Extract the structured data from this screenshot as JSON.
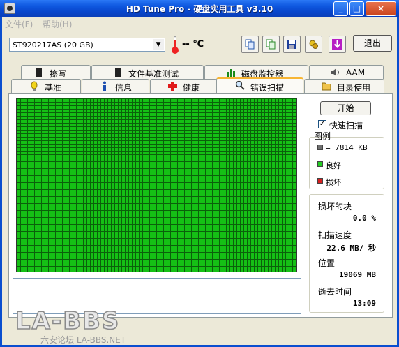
{
  "window": {
    "title": "HD Tune Pro - 硬盘实用工具 v3.10",
    "minimize": "_",
    "maximize": "□",
    "close": "×"
  },
  "menu": [
    {
      "label": "文件(F)"
    },
    {
      "label": "帮助(H)"
    }
  ],
  "drive": {
    "selected": "ST920217AS (20 GB)",
    "temperature": "-- ℃"
  },
  "toolbar": {
    "exit_label": "退出",
    "icons": [
      "copy-icon",
      "copy-info-icon",
      "save-icon",
      "settings-icon",
      "download-icon"
    ]
  },
  "tabs_top": [
    {
      "label": "擦写",
      "icon": "erase-icon"
    },
    {
      "label": "文件基准测试",
      "icon": "file-benchmark-icon"
    },
    {
      "label": "磁盘监控器",
      "icon": "disk-monitor-icon"
    },
    {
      "label": "AAM",
      "icon": "speaker-icon"
    }
  ],
  "tabs_bottom": [
    {
      "label": "基准",
      "icon": "benchmark-icon"
    },
    {
      "label": "信息",
      "icon": "info-icon"
    },
    {
      "label": "健康",
      "icon": "health-icon"
    },
    {
      "label": "错误扫描",
      "icon": "search-icon",
      "active": true
    },
    {
      "label": "目录使用",
      "icon": "folder-icon"
    }
  ],
  "scan": {
    "start_label": "开始",
    "quick_scan_label": "快速扫描",
    "quick_scan_checked": true,
    "grid_state": "all-good"
  },
  "legend": {
    "title": "图例",
    "block_size": "= 7814 KB",
    "good": "良好",
    "bad": "损坏",
    "colors": {
      "block": "#707070",
      "good": "#22cc22",
      "bad": "#d81f1f"
    }
  },
  "stats": {
    "damaged_label": "损坏的块",
    "damaged_value": "0.0 %",
    "speed_label": "扫描速度",
    "speed_value": "22.6 MB/ 秒",
    "position_label": "位置",
    "position_value": "19069 MB",
    "elapsed_label": "逝去时间",
    "elapsed_value": "13:09"
  },
  "watermark": {
    "logo": "LA-BBS",
    "sub": "六安论坛 LA-BBS.NET"
  }
}
